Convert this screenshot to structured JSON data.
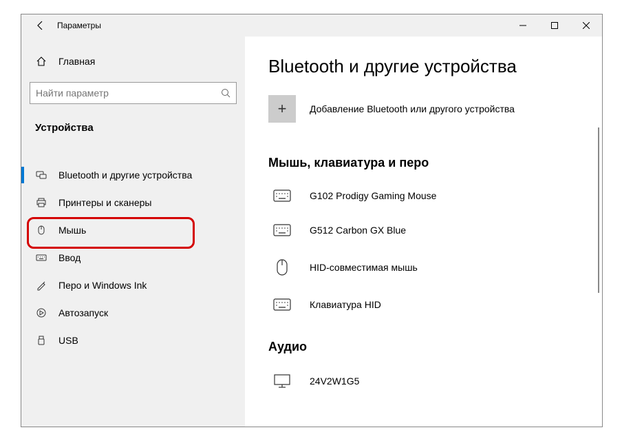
{
  "window": {
    "title": "Параметры"
  },
  "sidebar": {
    "home": "Главная",
    "search_placeholder": "Найти параметр",
    "category": "Устройства",
    "items": [
      {
        "label": "Bluetooth и другие устройства"
      },
      {
        "label": "Принтеры и сканеры"
      },
      {
        "label": "Мышь"
      },
      {
        "label": "Ввод"
      },
      {
        "label": "Перо и Windows Ink"
      },
      {
        "label": "Автозапуск"
      },
      {
        "label": "USB"
      }
    ]
  },
  "content": {
    "heading": "Bluetooth и другие устройства",
    "add_label": "Добавление Bluetooth или другого устройства",
    "section1": "Мышь, клавиатура и перо",
    "devices": [
      {
        "label": "G102 Prodigy Gaming Mouse"
      },
      {
        "label": "G512 Carbon GX Blue"
      },
      {
        "label": "HID-совместимая мышь"
      },
      {
        "label": "Клавиатура HID"
      }
    ],
    "section2": "Аудио",
    "audio_devices": [
      {
        "label": "24V2W1G5"
      }
    ]
  }
}
